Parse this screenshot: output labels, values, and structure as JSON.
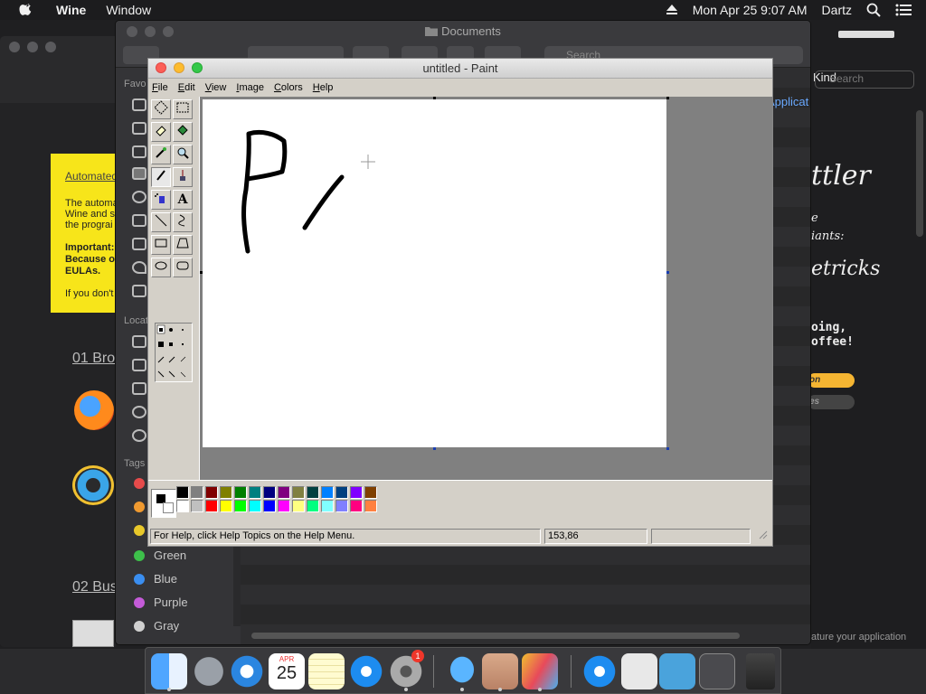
{
  "menubar": {
    "app_name": "Wine",
    "window_menu": "Window",
    "datetime": "Mon Apr 25  9:07 AM",
    "user": "Dartz"
  },
  "finder": {
    "title": "Documents",
    "search_placeholder": "Search",
    "sidebar_heads": {
      "favorites": "Favo",
      "locations": "Locat",
      "tags": "Tags"
    },
    "tags": [
      {
        "label": "Green",
        "color": "#3dbf4a"
      },
      {
        "label": "Blue",
        "color": "#3a8ef0"
      },
      {
        "label": "Purple",
        "color": "#c45bd8"
      },
      {
        "label": "Gray",
        "color": "#9a9a9a"
      }
    ],
    "column_kind": "Kind",
    "cell_applicat": "Applicat",
    "search_right": "Search"
  },
  "docwin": {
    "yellow_lines": [
      "Automated",
      "The automa",
      "Wine and s",
      "the prograi",
      "Important:",
      "Because o",
      "EULAs.",
      "If you don't"
    ],
    "heading1": "01 Bro",
    "heading2": "02 Bus"
  },
  "promo": {
    "line1": "ttler",
    "line2": "e",
    "line3": "iants:",
    "line4": "etricks",
    "line5": "oing,",
    "line6": "offee!",
    "btn1": "on",
    "btn2": "es",
    "footer": "ature your application"
  },
  "paint": {
    "title": "untitled - Paint",
    "menus": [
      "File",
      "Edit",
      "View",
      "Image",
      "Colors",
      "Help"
    ],
    "status_help": "For Help, click Help Topics on the Help Menu.",
    "status_coords": "153,86",
    "tools": [
      "free-select",
      "rect-select",
      "eraser",
      "fill",
      "color-picker",
      "magnifier",
      "pencil",
      "brush",
      "airbrush",
      "text",
      "line",
      "curve",
      "rectangle",
      "polygon",
      "ellipse",
      "rounded-rect"
    ],
    "palette_top": [
      "#000000",
      "#808080",
      "#800000",
      "#808000",
      "#008000",
      "#008080",
      "#000080",
      "#800080",
      "#808040",
      "#004040",
      "#0080ff",
      "#004080",
      "#8000ff",
      "#804000"
    ],
    "palette_bottom": [
      "#ffffff",
      "#c0c0c0",
      "#ff0000",
      "#ffff00",
      "#00ff00",
      "#00ffff",
      "#0000ff",
      "#ff00ff",
      "#ffff80",
      "#00ff80",
      "#80ffff",
      "#8080ff",
      "#ff0080",
      "#ff8040"
    ]
  },
  "dock": {
    "calendar_day": "25",
    "calendar_month": "APR",
    "badge": "1"
  }
}
